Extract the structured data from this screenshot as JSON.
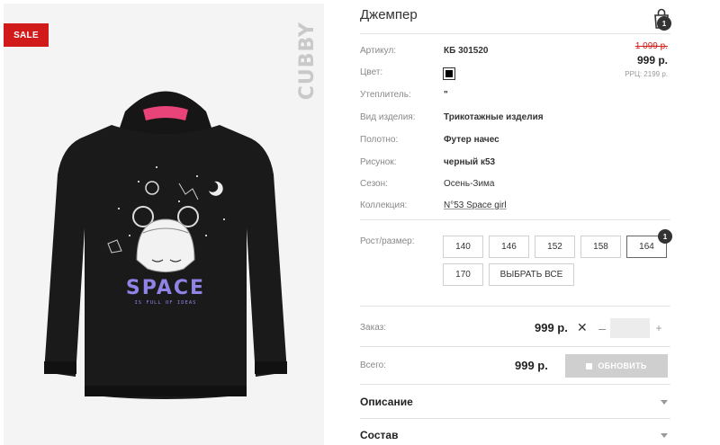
{
  "gallery": {
    "sale_label": "SALE",
    "brand": "CUBBY",
    "print_title": "SPACE",
    "print_subtitle": "IS FULL OF IDEAS"
  },
  "product": {
    "title": "Джемпер",
    "cart_count": "1",
    "price_old": "1 099 р.",
    "price_new": "999 р.",
    "price_rrc": "РРЦ: 2199 р."
  },
  "attributes": [
    {
      "label": "Артикул:",
      "value": "КБ 301520"
    },
    {
      "label": "Цвет:",
      "value": ""
    },
    {
      "label": "Утеплитель:",
      "value": "\""
    },
    {
      "label": "Вид изделия:",
      "value": "Трикотажные изделия"
    },
    {
      "label": "Полотно:",
      "value": "Футер начес"
    },
    {
      "label": "Рисунок:",
      "value": "черный к53"
    },
    {
      "label": "Сезон:",
      "value": "Осень-Зима"
    },
    {
      "label": "Коллекция:",
      "value": "N°53 Space girl"
    }
  ],
  "colors": {
    "swatch": "#000000",
    "sale": "#d11a1a"
  },
  "sizes": {
    "label": "Рост/размер:",
    "items": [
      "140",
      "146",
      "152",
      "158",
      "164",
      "170"
    ],
    "selected": "164",
    "selected_count": "1",
    "select_all": "ВЫБРАТЬ ВСЕ"
  },
  "order": {
    "label": "Заказ:",
    "price": "999 р.",
    "multiply": "✕",
    "minus": "–",
    "plus": "+",
    "quantity": ""
  },
  "total": {
    "label": "Всего:",
    "price": "999 р.",
    "button": "ОБНОВИТЬ"
  },
  "sections": [
    {
      "title": "Описание"
    },
    {
      "title": "Состав"
    }
  ]
}
